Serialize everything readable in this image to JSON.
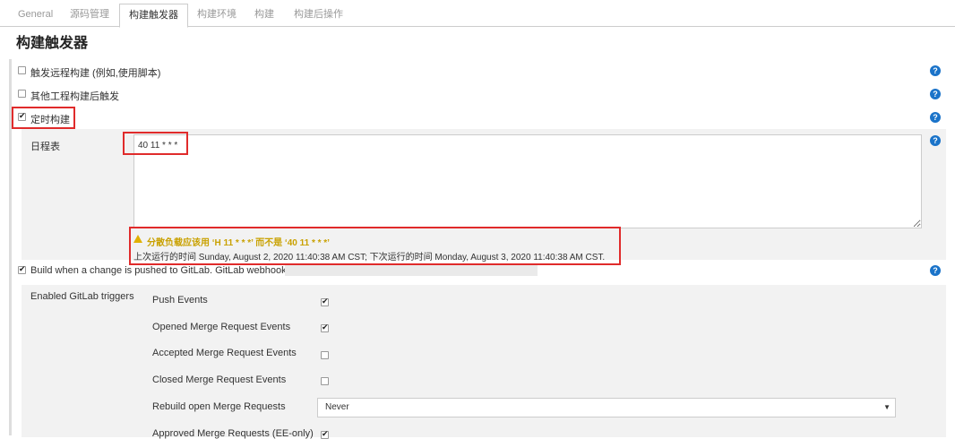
{
  "tabs": [
    "General",
    "源码管理",
    "构建触发器",
    "构建环境",
    "构建",
    "构建后操作"
  ],
  "section_title": "构建触发器",
  "triggers": {
    "remote": "触发远程构建 (例如,使用脚本)",
    "after_other": "其他工程构建后触发",
    "periodic": "定时构建"
  },
  "schedule": {
    "label": "日程表",
    "value": "40 11 * * *",
    "warning": "分散负载应该用 ‘H 11 * * *’ 而不是 ‘40 11 * * *’",
    "next_run": "上次运行的时间 Sunday, August 2, 2020 11:40:38 AM CST; 下次运行的时间 Monday, August 3, 2020 11:40:38 AM CST."
  },
  "gitlab": {
    "trigger_label": "Build when a change is pushed to GitLab. GitLab webhook URL:",
    "enabled_label": "Enabled GitLab triggers",
    "events": [
      {
        "label": "Push Events",
        "checked": true
      },
      {
        "label": "Opened Merge Request Events",
        "checked": true
      },
      {
        "label": "Accepted Merge Request Events",
        "checked": false
      },
      {
        "label": "Closed Merge Request Events",
        "checked": false
      }
    ],
    "rebuild_label": "Rebuild open Merge Requests",
    "rebuild_value": "Never",
    "approved_label": "Approved Merge Requests (EE-only)"
  },
  "help_symbol": "?",
  "colors": {
    "accent": "#1a73c9",
    "highlight": "#e02b2b",
    "warning": "#c9a100"
  }
}
